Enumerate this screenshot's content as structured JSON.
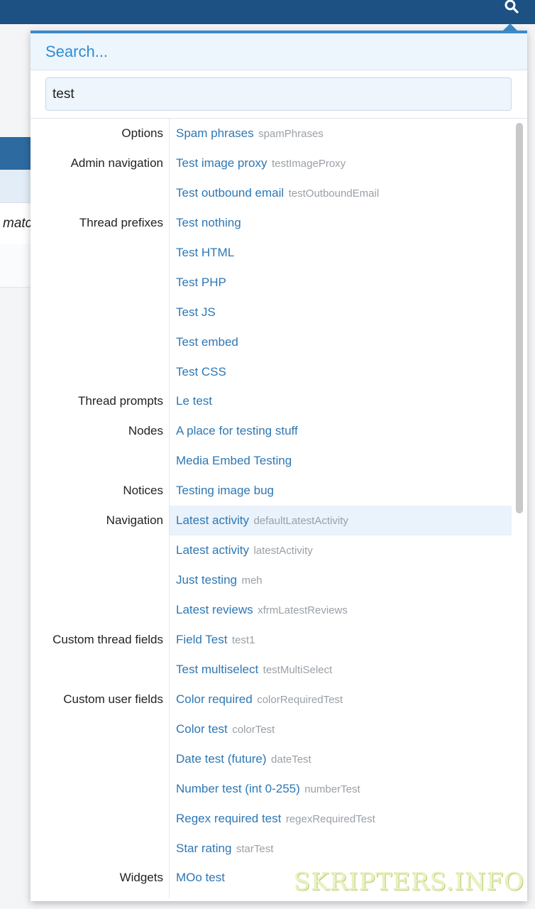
{
  "background": {
    "row_text": "matc"
  },
  "search": {
    "header": "Search...",
    "query": "test"
  },
  "results": [
    {
      "category": "Options",
      "title": "Spam phrases",
      "id": "spamPhrases"
    },
    {
      "category": "Admin navigation",
      "title": "Test image proxy",
      "id": "testImageProxy"
    },
    {
      "category": "",
      "title": "Test outbound email",
      "id": "testOutboundEmail"
    },
    {
      "category": "Thread prefixes",
      "title": "Test nothing",
      "id": ""
    },
    {
      "category": "",
      "title": "Test HTML",
      "id": ""
    },
    {
      "category": "",
      "title": "Test PHP",
      "id": ""
    },
    {
      "category": "",
      "title": "Test JS",
      "id": ""
    },
    {
      "category": "",
      "title": "Test embed",
      "id": ""
    },
    {
      "category": "",
      "title": "Test CSS",
      "id": ""
    },
    {
      "category": "Thread prompts",
      "title": "Le test",
      "id": ""
    },
    {
      "category": "Nodes",
      "title": "A place for testing stuff",
      "id": ""
    },
    {
      "category": "",
      "title": "Media Embed Testing",
      "id": ""
    },
    {
      "category": "Notices",
      "title": "Testing image bug",
      "id": ""
    },
    {
      "category": "Navigation",
      "title": "Latest activity",
      "id": "defaultLatestActivity",
      "highlighted": true
    },
    {
      "category": "",
      "title": "Latest activity",
      "id": "latestActivity"
    },
    {
      "category": "",
      "title": "Just testing",
      "id": "meh"
    },
    {
      "category": "",
      "title": "Latest reviews",
      "id": "xfrmLatestReviews"
    },
    {
      "category": "Custom thread fields",
      "title": "Field Test",
      "id": "test1"
    },
    {
      "category": "",
      "title": "Test multiselect",
      "id": "testMultiSelect"
    },
    {
      "category": "Custom user fields",
      "title": "Color required",
      "id": "colorRequiredTest"
    },
    {
      "category": "",
      "title": "Color test",
      "id": "colorTest"
    },
    {
      "category": "",
      "title": "Date test (future)",
      "id": "dateTest"
    },
    {
      "category": "",
      "title": "Number test (int 0-255)",
      "id": "numberTest"
    },
    {
      "category": "",
      "title": "Regex required test",
      "id": "regexRequiredTest"
    },
    {
      "category": "",
      "title": "Star rating",
      "id": "starTest"
    },
    {
      "category": "Widgets",
      "title": "MOo test",
      "id": ""
    }
  ],
  "watermark": "SKRIPTERS.INFO",
  "colors": {
    "topbar": "#1d5083",
    "accent": "#3e8ac7",
    "link": "#2e77b3"
  }
}
